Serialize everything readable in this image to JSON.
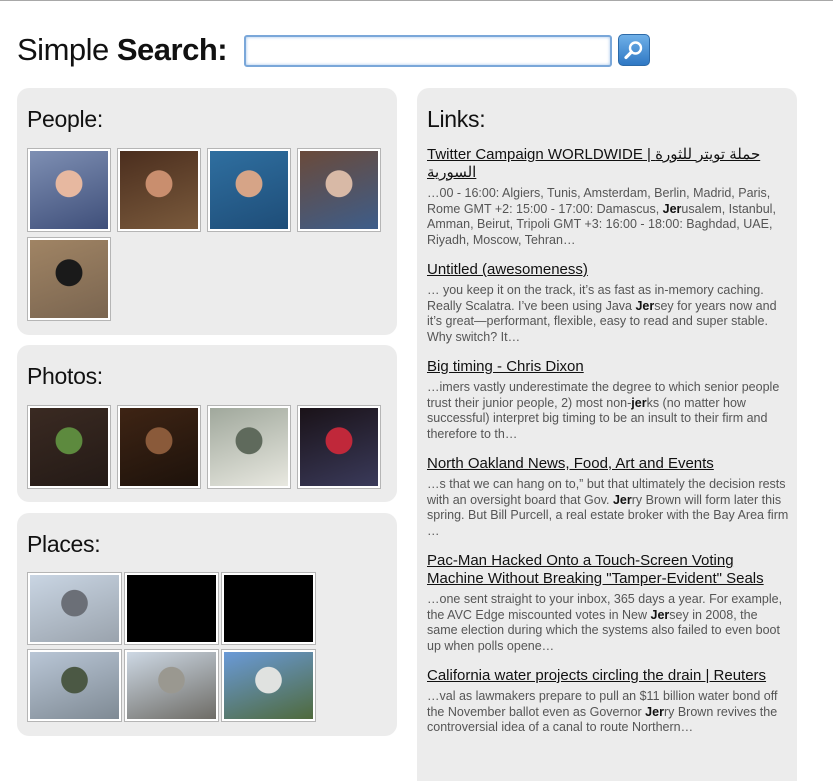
{
  "header": {
    "title_prefix": "Simple ",
    "title_bold": "Search:",
    "search_value": "",
    "search_button_icon": "magnifier-icon",
    "accent_color": "#3b84cf"
  },
  "people": {
    "heading": "People:",
    "images": [
      {
        "label": "person-1",
        "colors": [
          "#7e8fb3",
          "#e7b8a0",
          "#3f4f7a"
        ]
      },
      {
        "label": "person-2",
        "colors": [
          "#4b2e1e",
          "#c98e6e",
          "#7a5a3c"
        ]
      },
      {
        "label": "person-3",
        "colors": [
          "#2f6fa0",
          "#d6a487",
          "#1e4d78"
        ]
      },
      {
        "label": "person-4",
        "colors": [
          "#6a4a3a",
          "#d8b9a6",
          "#3d5d8a"
        ]
      },
      {
        "label": "person-5",
        "colors": [
          "#a08464",
          "#1a1a1a",
          "#7a6550"
        ]
      }
    ]
  },
  "photos": {
    "heading": "Photos:",
    "images": [
      {
        "label": "photo-1",
        "colors": [
          "#3a2a22",
          "#5d8a3e",
          "#241a16"
        ]
      },
      {
        "label": "photo-2",
        "colors": [
          "#3e2414",
          "#8a5a3a",
          "#1d120b"
        ]
      },
      {
        "label": "photo-3",
        "colors": [
          "#a0a89c",
          "#5f6a5c",
          "#e8e8e0"
        ]
      },
      {
        "label": "photo-4",
        "colors": [
          "#1a1218",
          "#c0283a",
          "#3a3a5a"
        ]
      }
    ]
  },
  "places": {
    "heading": "Places:",
    "images": [
      {
        "label": "place-1",
        "colors": [
          "#c9d5e3",
          "#6b6f77",
          "#9aa3ad"
        ]
      },
      {
        "label": "place-2",
        "colors": [
          "#000000",
          "#000000",
          "#000000"
        ]
      },
      {
        "label": "place-3",
        "colors": [
          "#000000",
          "#000000",
          "#000000"
        ]
      },
      {
        "label": "place-4",
        "colors": [
          "#b9c6d6",
          "#4b5844",
          "#7f8a94"
        ]
      },
      {
        "label": "place-5",
        "colors": [
          "#cdd8e4",
          "#9a9890",
          "#6e6c66"
        ]
      },
      {
        "label": "place-6",
        "colors": [
          "#6a9ad8",
          "#e0e2e0",
          "#4f6a3c"
        ]
      }
    ]
  },
  "links": {
    "heading": "Links:",
    "items": [
      {
        "title": "Twitter Campaign WORLDWIDE | حملة تويتر للثورة السورية",
        "snippet": "…00 - 16:00: Algiers, Tunis, Amsterdam, Berlin, Madrid, Paris, Rome GMT +2: 15:00 - 17:00: Damascus, Jerusalem, Istanbul, Amman, Beirut, Tripoli GMT +3: 16:00 - 18:00: Baghdad, UAE, Riyadh, Moscow, Tehran…",
        "bold": "Jer"
      },
      {
        "title": "Untitled (awesomeness)",
        "snippet": "… you keep it on the track, it’s as fast as in-memory caching. Really Scalatra. I’ve been using Java Jersey for years now and it’s great—performant, flexible, easy to read and super stable. Why switch? It…",
        "bold": "Jer"
      },
      {
        "title": "Big timing - Chris Dixon",
        "snippet": "…imers vastly underestimate the degree to which senior people trust their junior people, 2) most non-jerks (no matter how successful) interpret big timing to be an insult to their firm and therefore to th…",
        "bold": "jer"
      },
      {
        "title": "North Oakland News, Food, Art and Events",
        "snippet": "…s that we can hang on to,” but that ultimately the decision rests with an oversight board that Gov. Jerry Brown will form later this spring. But Bill Purcell, a real estate broker with the Bay Area firm …",
        "bold": "Jer"
      },
      {
        "title": "Pac-Man Hacked Onto a Touch-Screen Voting Machine Without Breaking \"Tamper-Evident\" Seals",
        "snippet": "…one sent straight to your inbox, 365 days a year. For example, the AVC Edge miscounted votes in New Jersey in 2008, the same election during which the systems also failed to even boot up when polls opene…",
        "bold": "Jer"
      },
      {
        "title": "California water projects circling the drain | Reuters",
        "snippet": "…val as lawmakers prepare to pull an $11 billion water bond off the November ballot even as Governor Jerry Brown revives the controversial idea of a canal to route Northern…",
        "bold": "Jer"
      }
    ]
  }
}
